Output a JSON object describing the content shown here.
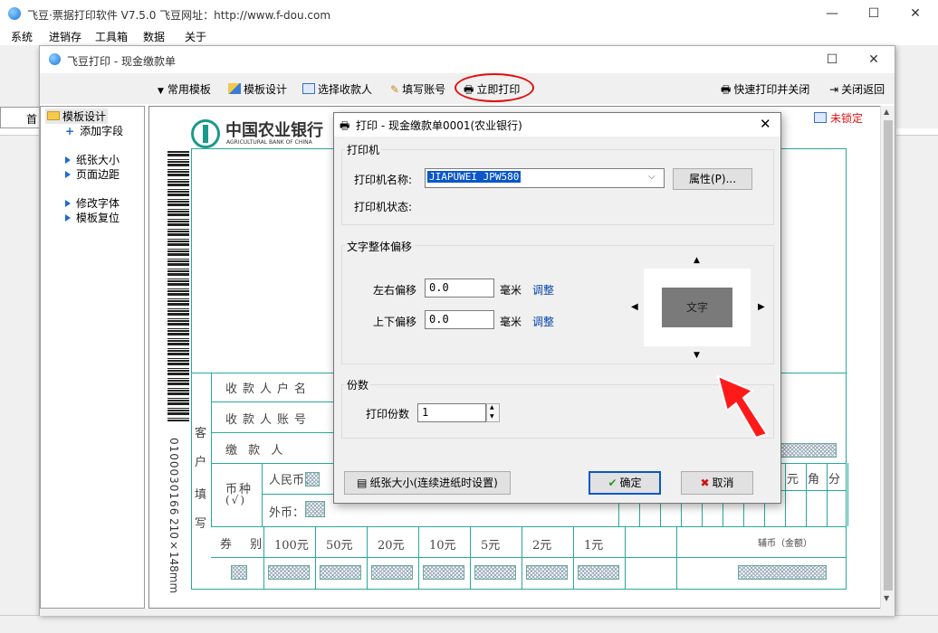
{
  "main_window": {
    "title": "飞豆·票据打印软件 V7.5.0   飞豆网址：http://www.f-dou.com",
    "menu": [
      "系统",
      "进销存",
      "工具箱",
      "数据",
      "关于"
    ],
    "tab_partial": "首"
  },
  "inner_window": {
    "title": "飞豆打印 - 现金缴款单",
    "toolbar": {
      "common_templates": "常用模板",
      "template_design": "模板设计",
      "select_payee": "选择收款人",
      "fill_account": "填写账号",
      "print_now": "立即打印",
      "quick_print_close": "快速打印并关闭",
      "close_return": "关闭返回"
    },
    "left_panel": {
      "root": "模板设计",
      "add_field": "添加字段",
      "paper_size": "纸张大小",
      "page_margin": "页面边距",
      "edit_font": "修改字体",
      "reset_template": "模板复位"
    },
    "lock_status": "未锁定"
  },
  "voucher": {
    "bank_name_cn": "中国农业银行",
    "bank_name_en": "AGRICULTURAL BANK OF CHINA",
    "side_code": "0100030166",
    "side_size": "210×148mm",
    "customer_label": [
      "客",
      "户",
      "填",
      "写"
    ],
    "rows": [
      "收款人户名",
      "收款人账号",
      "缴  款  人"
    ],
    "currency_type": "币种",
    "currency_check": "(√)",
    "rmb": "人民币：",
    "foreign": "外币：",
    "amount_units": [
      "元",
      "角",
      "分"
    ],
    "denom_label": "券 别",
    "denominations": [
      "100元",
      "50元",
      "20元",
      "10元",
      "5元",
      "2元",
      "1元"
    ],
    "coin_label": "辅币（金额）"
  },
  "dialog": {
    "title": "打印 - 现金缴款单0001(农业银行)",
    "printer_group": "打印机",
    "printer_name_label": "打印机名称:",
    "printer_name_value": "JIAPUWEI JPW580",
    "properties_button": "属性(P)...",
    "printer_status_label": "打印机状态:",
    "offset_group": "文字整体偏移",
    "lr_label": "左右偏移",
    "lr_value": "0.0",
    "ud_label": "上下偏移",
    "ud_value": "0.0",
    "unit": "毫米",
    "adjust": "调整",
    "preview_text": "文字",
    "copies_group": "份数",
    "copies_label": "打印份数",
    "copies_value": "1",
    "paper_size_button": "纸张大小(连续进纸时设置)",
    "ok_button": "确定",
    "cancel_button": "取消"
  },
  "colors": {
    "voucher_line": "#2aa89a",
    "highlight_red": "#e01010",
    "selection_blue": "#0a57c9"
  }
}
